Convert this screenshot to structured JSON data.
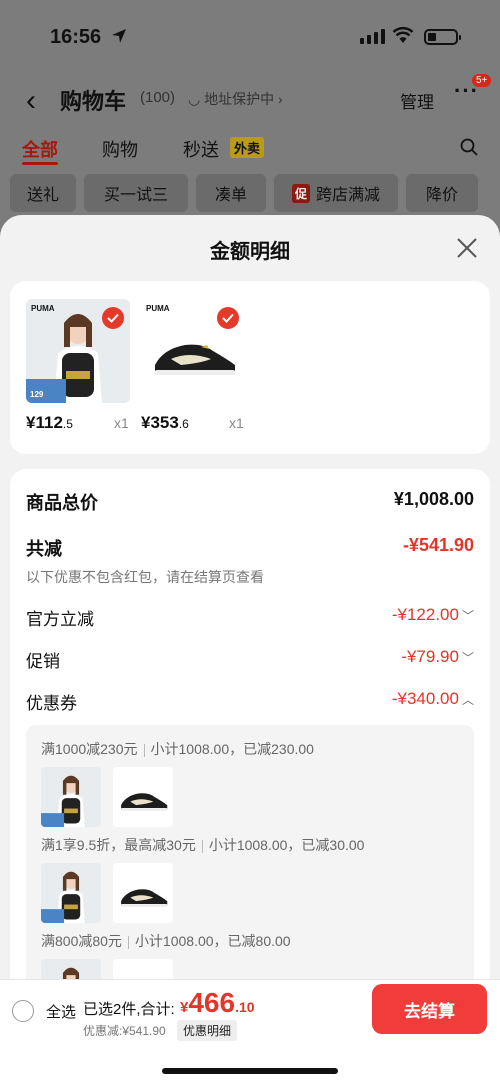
{
  "status": {
    "time": "16:56"
  },
  "nav": {
    "back": "‹",
    "title": "购物车",
    "count": "(100)",
    "address": "地址保护中",
    "manage": "管理",
    "more": "···",
    "more_badge": "5+"
  },
  "tabs": [
    {
      "label": "全部",
      "active": true
    },
    {
      "label": "购物"
    },
    {
      "label": "秒送"
    }
  ],
  "tab_badge": "外卖",
  "chips": [
    "送礼",
    "买一试三",
    "凑单",
    "跨店满减",
    "降价"
  ],
  "chip_badge": "促",
  "sheet": {
    "title": "金额明细",
    "products": [
      {
        "currency": "¥",
        "price_int": "112",
        "price_dec": ".5",
        "qty": "x1",
        "image_text": "PUMA",
        "tag_price": "129"
      },
      {
        "currency": "¥",
        "price_int": "353",
        "price_dec": ".6",
        "qty": "x1",
        "image_text": "PUMA"
      }
    ],
    "rows": {
      "total_label": "商品总价",
      "total_value": "¥1,008.00",
      "reduce_label": "共减",
      "reduce_value": "-¥541.90",
      "note": "以下优惠不包含红包，请在结算页查看",
      "official_label": "官方立减",
      "official_value": "-¥122.00",
      "promo_label": "促销",
      "promo_value": "-¥79.90",
      "coupon_label": "优惠券",
      "coupon_value": "-¥340.00"
    },
    "coupons": [
      {
        "rule": "满1000减230元",
        "detail": "小计1008.00，已减230.00"
      },
      {
        "rule": "满1享9.5折，最高减30元",
        "detail": "小计1008.00，已减30.00"
      },
      {
        "rule": "满800减80元",
        "detail": "小计1008.00，已减80.00"
      }
    ]
  },
  "footer": {
    "select_all": "全选",
    "selected": "已选2件,合计:",
    "currency": "¥",
    "total_int": "466",
    "total_dec": ".10",
    "discount": "优惠减:¥541.90",
    "detail_link": "优惠明细",
    "checkout": "去结算"
  },
  "colors": {
    "accent_red": "#e5352a",
    "checkout_bg": "#f13c3a",
    "tab_active": "#a8170e"
  }
}
